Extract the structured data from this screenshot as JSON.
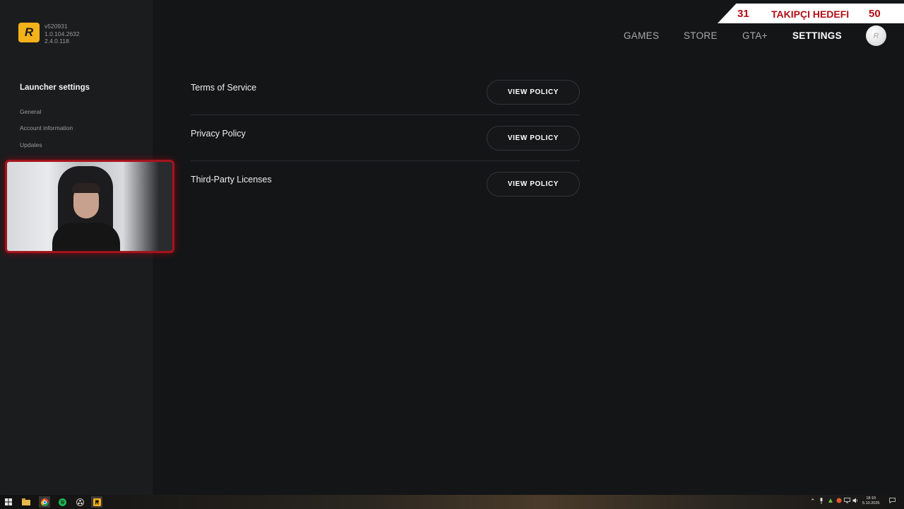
{
  "app": {
    "logo_letter": "R",
    "versions": [
      "v520931",
      "1.0.104.2632",
      "2.4.0.118"
    ]
  },
  "sidebar": {
    "title": "Launcher settings",
    "items": [
      {
        "label": "General"
      },
      {
        "label": "Account information"
      },
      {
        "label": "Updates"
      }
    ]
  },
  "nav": {
    "items": [
      {
        "label": "GAMES"
      },
      {
        "label": "STORE"
      },
      {
        "label": "GTA+"
      },
      {
        "label": "SETTINGS",
        "active": true
      }
    ],
    "avatar_letter": "R"
  },
  "overlay": {
    "current": "31",
    "label": "TAKIPÇI HEDEFI",
    "goal": "50"
  },
  "policies": [
    {
      "label": "Terms of Service",
      "button": "VIEW POLICY"
    },
    {
      "label": "Privacy Policy",
      "button": "VIEW POLICY"
    },
    {
      "label": "Third-Party Licenses",
      "button": "VIEW POLICY"
    }
  ],
  "taskbar": {
    "time": "18:10",
    "date": "5.10.2025"
  },
  "colors": {
    "background": "#141517",
    "sidebar": "#1b1c1e",
    "logo": "#f4b21a",
    "overlay_accent": "#b10f16",
    "webcam_border": "#a4141c"
  }
}
